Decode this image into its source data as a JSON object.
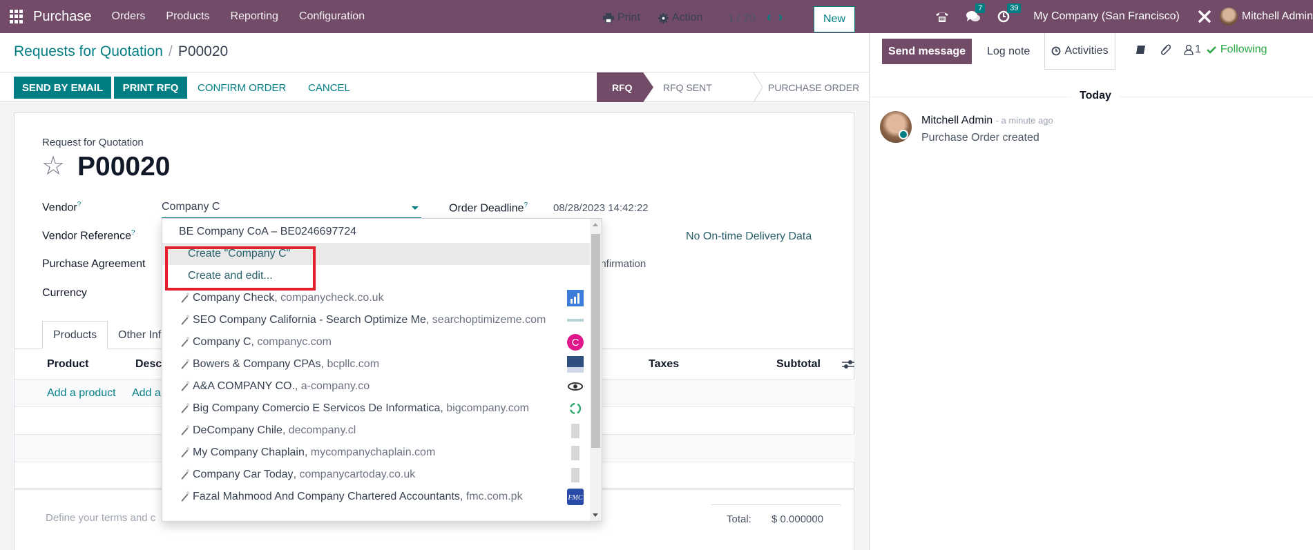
{
  "topbar": {
    "app_name": "Purchase",
    "menu": [
      "Orders",
      "Products",
      "Reporting",
      "Configuration"
    ],
    "messages_count": "7",
    "activities_count": "39",
    "company": "My Company (San Francisco)",
    "user": "Mitchell Admin",
    "brand_color": "#714b67"
  },
  "control_panel": {
    "breadcrumb_parent": "Requests for Quotation",
    "breadcrumb_sep": "/",
    "breadcrumb_current": "P00020",
    "print_label": "Print",
    "action_label": "Action",
    "pager": "1 / 20",
    "new_label": "New"
  },
  "statusbar": {
    "buttons": [
      "SEND BY EMAIL",
      "PRINT RFQ",
      "CONFIRM ORDER",
      "CANCEL"
    ],
    "stages": [
      "RFQ",
      "RFQ SENT",
      "PURCHASE ORDER"
    ],
    "active_stage": "RFQ",
    "accent_color": "#017e84"
  },
  "form": {
    "subtitle": "Request for Quotation",
    "record_name": "P00020",
    "fields": {
      "vendor_label": "Vendor",
      "vendor_value": "Company C",
      "vendor_reference_label": "Vendor Reference",
      "purchase_agreement_label": "Purchase Agreement",
      "currency_label": "Currency",
      "order_deadline_label": "Order Deadline",
      "order_deadline_value": "08/28/2023 14:42:22",
      "on_time_delivery": "No On-time Delivery Data",
      "confirmation_partial": "onfirmation",
      "help_mark": "?"
    },
    "tabs": [
      "Products",
      "Other Inf"
    ],
    "table": {
      "columns": [
        "Product",
        "Descr",
        "Taxes",
        "Subtotal"
      ],
      "add_product": "Add a product",
      "add_section_partial": "Add a"
    },
    "terms_placeholder": "Define your terms and c",
    "total_label": "Total:",
    "total_value": "$ 0.000000"
  },
  "vendor_dropdown": {
    "first_item": "BE Company CoA – BE0246697724",
    "create_option": "Create \"Company C\"",
    "create_edit_option": "Create and edit...",
    "suggestions": [
      {
        "name": "Company Check",
        "domain": "companycheck.co.uk",
        "logo": "bar-chart-logo"
      },
      {
        "name": "SEO Company California - Search Optimize Me",
        "domain": "searchoptimizeme.com",
        "logo": "text-logo"
      },
      {
        "name": "Company C",
        "domain": "companyc.com",
        "logo": "pink-c-logo"
      },
      {
        "name": "Bowers & Company CPAs",
        "domain": "bcpllc.com",
        "logo": "blue-box-logo"
      },
      {
        "name": "A&A COMPANY CO.",
        "domain": "a-company.co",
        "logo": "eye-logo"
      },
      {
        "name": "Big Company Comercio E Servicos De Informatica",
        "domain": "bigcompany.com",
        "logo": "recycle-logo"
      },
      {
        "name": "DeCompany Chile",
        "domain": "decompany.cl",
        "logo": "building-logo"
      },
      {
        "name": "My Company Chaplain",
        "domain": "mycompanychaplain.com",
        "logo": "building-logo"
      },
      {
        "name": "Company Car Today",
        "domain": "companycartoday.co.uk",
        "logo": "building-logo"
      },
      {
        "name": "Fazal Mahmood And Company Chartered Accountants",
        "domain": "fmc.com.pk",
        "logo": "fmc-logo"
      }
    ]
  },
  "chatter": {
    "send_message": "Send message",
    "log_note": "Log note",
    "activities": "Activities",
    "followers_count": "1",
    "following": "Following",
    "date_separator": "Today",
    "messages": [
      {
        "author": "Mitchell Admin",
        "time": "- a minute ago",
        "body": "Purchase Order created"
      }
    ]
  }
}
